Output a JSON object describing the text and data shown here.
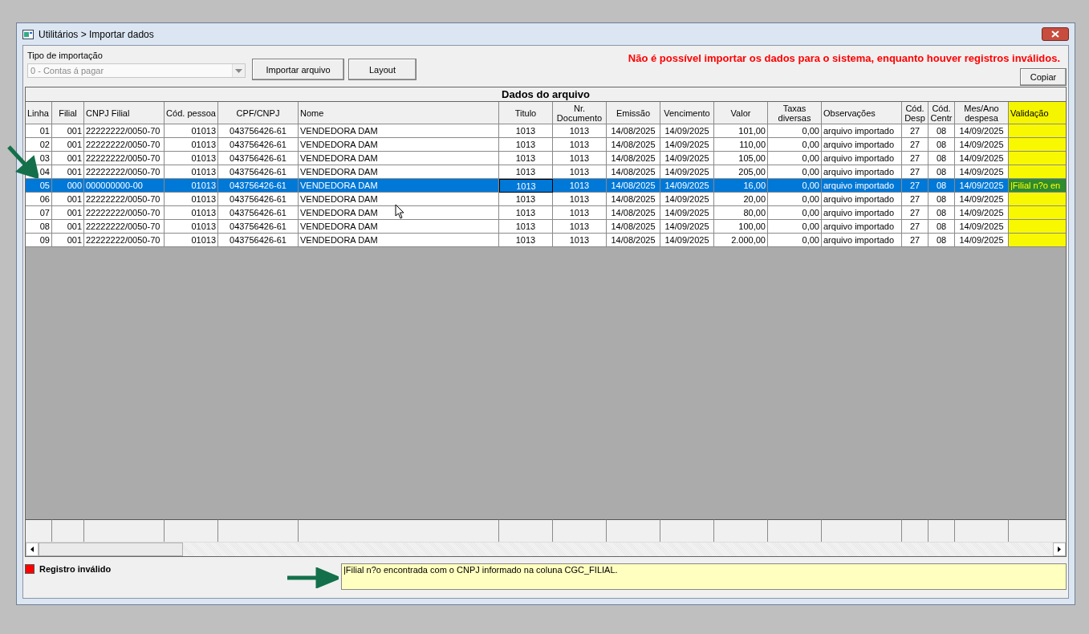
{
  "window": {
    "title": "Utilitários > Importar dados"
  },
  "import_type": {
    "label": "Tipo de importação",
    "value": "0 - Contas á pagar",
    "disabled": true
  },
  "buttons": [
    "Importar arquivo",
    "Layout"
  ],
  "error_message": "Não é possível importar os dados para o sistema, enquanto houver registros inválidos.",
  "copy_button": "Copiar",
  "table": {
    "title": "Dados do arquivo",
    "columns": [
      "Linha",
      "Filial",
      "CNPJ Filial",
      "Cód. pessoa",
      "CPF/CNPJ",
      "Nome",
      "Titulo",
      "Nr. Documento",
      "Emissão",
      "Vencimento",
      "Valor",
      "Taxas diversas",
      "Observações",
      "Cód. Desp",
      "Cód. Centr",
      "Mes/Ano despesa",
      "Validação"
    ],
    "rows": [
      {
        "selected": false,
        "invalid": false,
        "cells": [
          "01",
          "001",
          "22222222/0050-70",
          "01013",
          "043756426-61",
          "VENDEDORA DAM",
          "1013",
          "1013",
          "14/08/2025",
          "14/09/2025",
          "101,00",
          "0,00",
          "arquivo importado",
          "27",
          "08",
          "14/09/2025",
          ""
        ]
      },
      {
        "selected": false,
        "invalid": false,
        "cells": [
          "02",
          "001",
          "22222222/0050-70",
          "01013",
          "043756426-61",
          "VENDEDORA DAM",
          "1013",
          "1013",
          "14/08/2025",
          "14/09/2025",
          "110,00",
          "0,00",
          "arquivo importado",
          "27",
          "08",
          "14/09/2025",
          ""
        ]
      },
      {
        "selected": false,
        "invalid": false,
        "cells": [
          "03",
          "001",
          "22222222/0050-70",
          "01013",
          "043756426-61",
          "VENDEDORA DAM",
          "1013",
          "1013",
          "14/08/2025",
          "14/09/2025",
          "105,00",
          "0,00",
          "arquivo importado",
          "27",
          "08",
          "14/09/2025",
          ""
        ]
      },
      {
        "selected": false,
        "invalid": false,
        "cells": [
          "04",
          "001",
          "22222222/0050-70",
          "01013",
          "043756426-61",
          "VENDEDORA DAM",
          "1013",
          "1013",
          "14/08/2025",
          "14/09/2025",
          "205,00",
          "0,00",
          "arquivo importado",
          "27",
          "08",
          "14/09/2025",
          ""
        ]
      },
      {
        "selected": true,
        "invalid": true,
        "cells": [
          "05",
          "000",
          "000000000-00",
          "01013",
          "043756426-61",
          "VENDEDORA DAM",
          "1013",
          "1013",
          "14/08/2025",
          "14/09/2025",
          "16,00",
          "0,00",
          "arquivo importado",
          "27",
          "08",
          "14/09/2025",
          "|Filial n?o en"
        ]
      },
      {
        "selected": false,
        "invalid": false,
        "cells": [
          "06",
          "001",
          "22222222/0050-70",
          "01013",
          "043756426-61",
          "VENDEDORA DAM",
          "1013",
          "1013",
          "14/08/2025",
          "14/09/2025",
          "20,00",
          "0,00",
          "arquivo importado",
          "27",
          "08",
          "14/09/2025",
          ""
        ]
      },
      {
        "selected": false,
        "invalid": false,
        "cells": [
          "07",
          "001",
          "22222222/0050-70",
          "01013",
          "043756426-61",
          "VENDEDORA DAM",
          "1013",
          "1013",
          "14/08/2025",
          "14/09/2025",
          "80,00",
          "0,00",
          "arquivo importado",
          "27",
          "08",
          "14/09/2025",
          ""
        ]
      },
      {
        "selected": false,
        "invalid": false,
        "cells": [
          "08",
          "001",
          "22222222/0050-70",
          "01013",
          "043756426-61",
          "VENDEDORA DAM",
          "1013",
          "1013",
          "14/08/2025",
          "14/09/2025",
          "100,00",
          "0,00",
          "arquivo importado",
          "27",
          "08",
          "14/09/2025",
          ""
        ]
      },
      {
        "selected": false,
        "invalid": false,
        "cells": [
          "09",
          "001",
          "22222222/0050-70",
          "01013",
          "043756426-61",
          "VENDEDORA DAM",
          "1013",
          "1013",
          "14/08/2025",
          "14/09/2025",
          "2.000,00",
          "0,00",
          "arquivo importado",
          "27",
          "08",
          "14/09/2025",
          ""
        ]
      }
    ]
  },
  "legend": {
    "label": "Registro inválido",
    "color": "#ff0000"
  },
  "validation_message": "|Filial n?o encontrada com o CNPJ informado na coluna CGC_FILIAL."
}
